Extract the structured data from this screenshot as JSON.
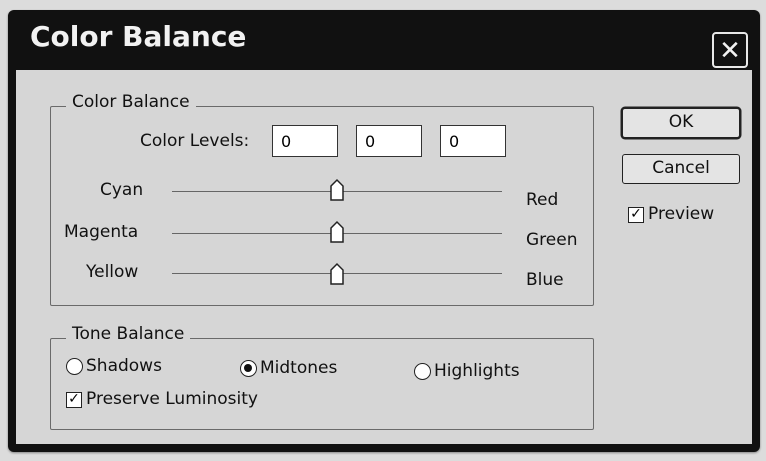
{
  "window": {
    "title": "Color Balance",
    "close_glyph": "✕"
  },
  "color_balance": {
    "group_label": "Color Balance",
    "levels_label": "Color Levels:",
    "levels": [
      "0",
      "0",
      "0"
    ],
    "sliders": [
      {
        "left": "Cyan",
        "right": "Red",
        "value": 0
      },
      {
        "left": "Magenta",
        "right": "Green",
        "value": 0
      },
      {
        "left": "Yellow",
        "right": "Blue",
        "value": 0
      }
    ]
  },
  "tone_balance": {
    "group_label": "Tone Balance",
    "options": [
      {
        "label": "Shadows",
        "selected": false
      },
      {
        "label": "Midtones",
        "selected": true
      },
      {
        "label": "Highlights",
        "selected": false
      }
    ],
    "preserve_luminosity": {
      "label": "Preserve Luminosity",
      "checked": true
    }
  },
  "buttons": {
    "ok": "OK",
    "cancel": "Cancel"
  },
  "preview": {
    "label": "Preview",
    "checked": true
  },
  "glyphs": {
    "check": "✓"
  }
}
